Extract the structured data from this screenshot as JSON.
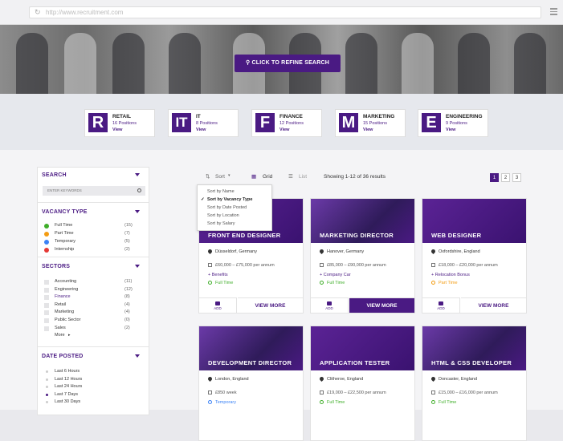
{
  "browser": {
    "url": "http://www.recruitment.com"
  },
  "hero": {
    "refine_label": "CLICK TO REFINE SEARCH"
  },
  "categories": [
    {
      "letter": "R",
      "name": "RETAIL",
      "positions": "16 Positions",
      "view": "View"
    },
    {
      "letter": "IT",
      "name": "IT",
      "positions": "8 Positions",
      "view": "View"
    },
    {
      "letter": "F",
      "name": "FINANCE",
      "positions": "12 Positions",
      "view": "View"
    },
    {
      "letter": "M",
      "name": "MARKETING",
      "positions": "15 Positions",
      "view": "View"
    },
    {
      "letter": "E",
      "name": "ENGINEERING",
      "positions": "9 Positions",
      "view": "View"
    }
  ],
  "sidebar": {
    "search": {
      "title": "SEARCH",
      "placeholder": "ENTER KEYWORDS"
    },
    "vacancy": {
      "title": "VACANCY TYPE",
      "items": [
        {
          "label": "Full Time",
          "count": "(15)",
          "color": "#3fae29"
        },
        {
          "label": "Part Time",
          "count": "(7)",
          "color": "#f39c12"
        },
        {
          "label": "Temporary",
          "count": "(5)",
          "color": "#3b82f6"
        },
        {
          "label": "Internship",
          "count": "(2)",
          "color": "#e53935"
        }
      ]
    },
    "sectors": {
      "title": "SECTORS",
      "items": [
        {
          "label": "Accounting",
          "count": "(11)"
        },
        {
          "label": "Engineering",
          "count": "(12)"
        },
        {
          "label": "Finance",
          "count": "(8)"
        },
        {
          "label": "Retail",
          "count": "(4)"
        },
        {
          "label": "Marketing",
          "count": "(4)"
        },
        {
          "label": "Public Sector",
          "count": "(0)"
        },
        {
          "label": "Sales",
          "count": "(2)"
        }
      ],
      "more": "More"
    },
    "date": {
      "title": "DATE POSTED",
      "items": [
        "Last 6 Hours",
        "Last 12 Hours",
        "Last 24 Hours",
        "Last 7 Days",
        "Last 30 Days"
      ]
    }
  },
  "toolbar": {
    "sort": "Sort",
    "grid": "Grid",
    "list": "List",
    "showing": "Showing 1-12 of 36 results",
    "pages": [
      "1",
      "2",
      "3"
    ]
  },
  "sort_menu": [
    "Sort by Name",
    "Sort by Vacancy Type",
    "Sort by Date Posted",
    "Sort by Location",
    "Sort by Salary"
  ],
  "jobs": [
    {
      "title": "FRONT END DESIGNER",
      "location": "Düsseldorf, Germany",
      "salary": "£60,000 – £75,000 per annum",
      "extra": "+ Benefits",
      "type": "Full Time",
      "type_color": "#3fae29",
      "add": "ADD",
      "view": "VIEW MORE"
    },
    {
      "title": "MARKETING DIRECTOR",
      "location": "Hanover, Germany",
      "salary": "£85,000 – £90,000 per annum",
      "extra": "+ Company Car",
      "type": "Full Time",
      "type_color": "#3fae29",
      "add": "ADD",
      "view": "VIEW MORE"
    },
    {
      "title": "WEB DESIGNER",
      "location": "Oxfordshire, England",
      "salary": "£18,000 – £20,000 per annum",
      "extra": "+ Relocation Bonus",
      "type": "Part Time",
      "type_color": "#f39c12",
      "add": "ADD",
      "view": "VIEW MORE"
    },
    {
      "title": "DEVELOPMENT DIRECTOR",
      "location": "London, England",
      "salary": "£850 week",
      "extra": "",
      "type": "Temporary",
      "type_color": "#3b82f6"
    },
    {
      "title": "APPLICATION TESTER",
      "location": "Clitheroe, England",
      "salary": "£19,000 – £22,500 per annum",
      "extra": "",
      "type": "Full Time",
      "type_color": "#3fae29"
    },
    {
      "title": "HTML & CSS DEVELOPER",
      "location": "Doncaster, England",
      "salary": "£15,000 – £16,000 per annum",
      "extra": "",
      "type": "Full Time",
      "type_color": "#3fae29"
    }
  ]
}
